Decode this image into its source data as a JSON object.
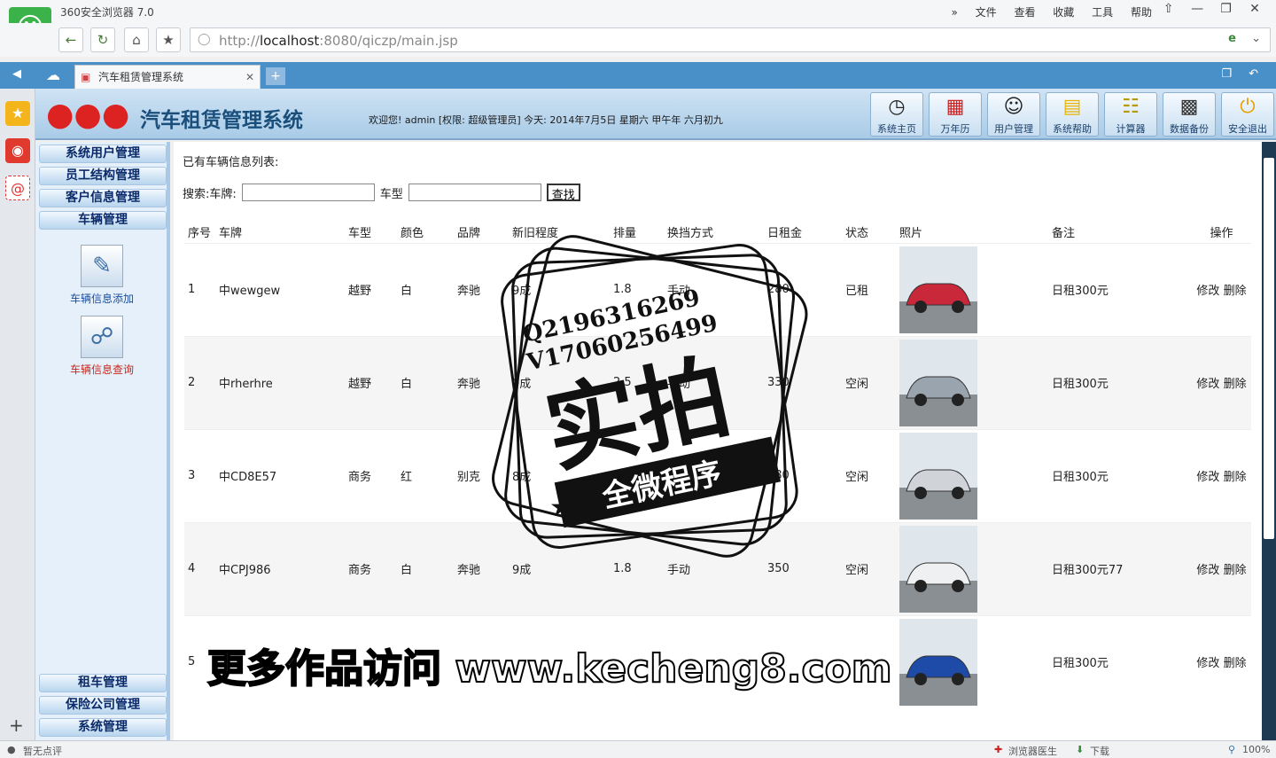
{
  "browser": {
    "title": "360安全浏览器 7.0",
    "menus": [
      "文件",
      "查看",
      "收藏",
      "工具",
      "帮助"
    ],
    "url_gray": "http://",
    "url_host": "localhost",
    "url_rest": ":8080/qiczp/main.jsp",
    "tab_title": "汽车租赁管理系统",
    "status_left": "暂无点评",
    "status_doctor": "浏览器医生",
    "status_download": "下载",
    "zoom": "100%"
  },
  "header": {
    "system_title": "汽车租赁管理系统",
    "welcome": "欢迎您! admin [权限: 超级管理员] 今天: 2014年7月5日 星期六 甲午年 六月初九",
    "buttons": [
      "系统主页",
      "万年历",
      "用户管理",
      "系统帮助",
      "计算器",
      "数据备份",
      "安全退出"
    ]
  },
  "sidebar": {
    "menus_top": [
      "系统用户管理",
      "员工结构管理",
      "客户信息管理",
      "车辆管理"
    ],
    "sub_items": [
      "车辆信息添加",
      "车辆信息查询"
    ],
    "menus_bottom": [
      "租车管理",
      "保险公司管理",
      "系统管理"
    ]
  },
  "main": {
    "list_title": "已有车辆信息列表:",
    "search_label_plate": "搜索:车牌:",
    "search_label_type": "车型",
    "search_button": "查找",
    "columns": [
      "序号",
      "车牌",
      "车型",
      "颜色",
      "品牌",
      "新旧程度",
      "排量",
      "换挡方式",
      "日租金",
      "状态",
      "照片",
      "备注",
      "操作"
    ],
    "rows": [
      {
        "no": "1",
        "plate": "中wewgew",
        "type": "越野",
        "color": "白",
        "brand": "奔驰",
        "cond": "9成",
        "disp": "1.8",
        "gear": "手动",
        "rent": "280",
        "status": "已租",
        "note": "日租300元"
      },
      {
        "no": "2",
        "plate": "中rherhre",
        "type": "越野",
        "color": "白",
        "brand": "奔驰",
        "cond": "9成",
        "disp": "2.5",
        "gear": "手动",
        "rent": "330",
        "status": "空闲",
        "note": "日租300元"
      },
      {
        "no": "3",
        "plate": "中CD8E57",
        "type": "商务",
        "color": "红",
        "brand": "别克",
        "cond": "8成",
        "disp": "",
        "gear": "",
        "rent": "280",
        "status": "空闲",
        "note": "日租300元"
      },
      {
        "no": "4",
        "plate": "中CPJ986",
        "type": "商务",
        "color": "白",
        "brand": "奔驰",
        "cond": "9成",
        "disp": "1.8",
        "gear": "手动",
        "rent": "350",
        "status": "空闲",
        "note": "日租300元77"
      },
      {
        "no": "5",
        "plate": "",
        "type": "",
        "color": "",
        "brand": "",
        "cond": "",
        "disp": "",
        "gear": "",
        "rent": "",
        "status": "",
        "note": "日租300元"
      }
    ],
    "op_edit": "修改",
    "op_delete": "删除"
  },
  "stamp": {
    "qq": "Q2196316269",
    "wechat": "V17060256499",
    "big": "实拍",
    "banner": "全微程序"
  },
  "watermark": "更多作品访问 www.kecheng8.com",
  "colors": {
    "accent": "#4a90c8",
    "header_bg": "#a9cbe7",
    "sidebar_bg": "#e6f0fa"
  }
}
